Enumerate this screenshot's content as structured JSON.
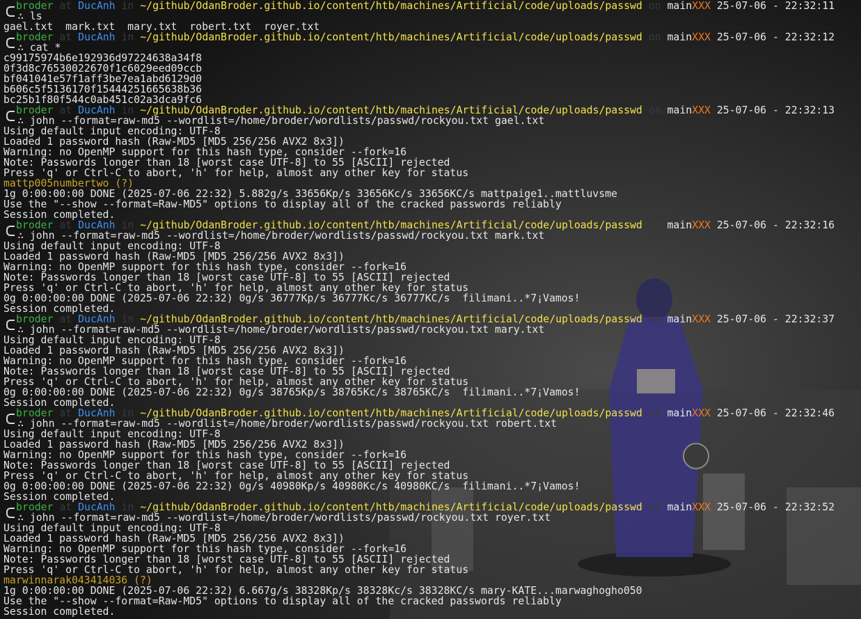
{
  "prompt": {
    "user": "broder",
    "at": "at",
    "host": "DucAnh",
    "in": "in",
    "path": "~/github/OdanBroder.github.io/content/htb/machines/Artificial/code/uploads/passwd",
    "on": "on",
    "branch": "main",
    "flags": "XXX",
    "arrow": "∴"
  },
  "colors": {
    "user": "#3cb043",
    "host": "#3f8ff0",
    "path": "#f4e24a",
    "flags": "#f07a1e",
    "found": "#c9a227"
  },
  "lines": [
    {
      "type": "prompt",
      "time": "25-07-06 - 22:32:11"
    },
    {
      "type": "cmd",
      "text": "ls"
    },
    {
      "type": "out",
      "text": "gael.txt  mark.txt  mary.txt  robert.txt  royer.txt"
    },
    {
      "type": "prompt",
      "time": "25-07-06 - 22:32:12"
    },
    {
      "type": "cmd",
      "text": "cat *"
    },
    {
      "type": "out",
      "text": "c99175974b6e192936d97224638a34f8"
    },
    {
      "type": "out",
      "text": "0f3d8c76530022670f1c6029eed09ccb"
    },
    {
      "type": "out",
      "text": "bf041041e57f1aff3be7ea1abd6129d0"
    },
    {
      "type": "out",
      "text": "b606c5f5136170f15444251665638b36"
    },
    {
      "type": "out",
      "text": "bc25b1f80f544c0ab451c02a3dca9fc6"
    },
    {
      "type": "prompt",
      "time": "25-07-06 - 22:32:13"
    },
    {
      "type": "cmd",
      "text": "john --format=raw-md5 --wordlist=/home/broder/wordlists/passwd/rockyou.txt gael.txt"
    },
    {
      "type": "out",
      "text": "Using default input encoding: UTF-8"
    },
    {
      "type": "out",
      "text": "Loaded 1 password hash (Raw-MD5 [MD5 256/256 AVX2 8x3])"
    },
    {
      "type": "out",
      "text": "Warning: no OpenMP support for this hash type, consider --fork=16"
    },
    {
      "type": "out",
      "text": "Note: Passwords longer than 18 [worst case UTF-8] to 55 [ASCII] rejected"
    },
    {
      "type": "out",
      "text": "Press 'q' or Ctrl-C to abort, 'h' for help, almost any other key for status"
    },
    {
      "type": "found",
      "text": "mattp005numbertwo (?)"
    },
    {
      "type": "out",
      "text": "1g 0:00:00:00 DONE (2025-07-06 22:32) 5.882g/s 33656Kp/s 33656Kc/s 33656KC/s mattpaige1..mattluvsme"
    },
    {
      "type": "out",
      "text": "Use the \"--show --format=Raw-MD5\" options to display all of the cracked passwords reliably"
    },
    {
      "type": "out",
      "text": "Session completed."
    },
    {
      "type": "prompt",
      "time": "25-07-06 - 22:32:16"
    },
    {
      "type": "cmd",
      "text": "john --format=raw-md5 --wordlist=/home/broder/wordlists/passwd/rockyou.txt mark.txt"
    },
    {
      "type": "out",
      "text": "Using default input encoding: UTF-8"
    },
    {
      "type": "out",
      "text": "Loaded 1 password hash (Raw-MD5 [MD5 256/256 AVX2 8x3])"
    },
    {
      "type": "out",
      "text": "Warning: no OpenMP support for this hash type, consider --fork=16"
    },
    {
      "type": "out",
      "text": "Note: Passwords longer than 18 [worst case UTF-8] to 55 [ASCII] rejected"
    },
    {
      "type": "out",
      "text": "Press 'q' or Ctrl-C to abort, 'h' for help, almost any other key for status"
    },
    {
      "type": "out",
      "text": "0g 0:00:00:00 DONE (2025-07-06 22:32) 0g/s 36777Kp/s 36777Kc/s 36777KC/s  filimani..*7¡Vamos!"
    },
    {
      "type": "out",
      "text": "Session completed."
    },
    {
      "type": "prompt",
      "time": "25-07-06 - 22:32:37"
    },
    {
      "type": "cmd",
      "text": "john --format=raw-md5 --wordlist=/home/broder/wordlists/passwd/rockyou.txt mary.txt"
    },
    {
      "type": "out",
      "text": "Using default input encoding: UTF-8"
    },
    {
      "type": "out",
      "text": "Loaded 1 password hash (Raw-MD5 [MD5 256/256 AVX2 8x3])"
    },
    {
      "type": "out",
      "text": "Warning: no OpenMP support for this hash type, consider --fork=16"
    },
    {
      "type": "out",
      "text": "Note: Passwords longer than 18 [worst case UTF-8] to 55 [ASCII] rejected"
    },
    {
      "type": "out",
      "text": "Press 'q' or Ctrl-C to abort, 'h' for help, almost any other key for status"
    },
    {
      "type": "out",
      "text": "0g 0:00:00:00 DONE (2025-07-06 22:32) 0g/s 38765Kp/s 38765Kc/s 38765KC/s  filimani..*7¡Vamos!"
    },
    {
      "type": "out",
      "text": "Session completed."
    },
    {
      "type": "prompt",
      "time": "25-07-06 - 22:32:46"
    },
    {
      "type": "cmd",
      "text": "john --format=raw-md5 --wordlist=/home/broder/wordlists/passwd/rockyou.txt robert.txt"
    },
    {
      "type": "out",
      "text": "Using default input encoding: UTF-8"
    },
    {
      "type": "out",
      "text": "Loaded 1 password hash (Raw-MD5 [MD5 256/256 AVX2 8x3])"
    },
    {
      "type": "out",
      "text": "Warning: no OpenMP support for this hash type, consider --fork=16"
    },
    {
      "type": "out",
      "text": "Note: Passwords longer than 18 [worst case UTF-8] to 55 [ASCII] rejected"
    },
    {
      "type": "out",
      "text": "Press 'q' or Ctrl-C to abort, 'h' for help, almost any other key for status"
    },
    {
      "type": "out",
      "text": "0g 0:00:00:00 DONE (2025-07-06 22:32) 0g/s 40980Kp/s 40980Kc/s 40980KC/s  filimani..*7¡Vamos!"
    },
    {
      "type": "out",
      "text": "Session completed."
    },
    {
      "type": "prompt",
      "time": "25-07-06 - 22:32:52"
    },
    {
      "type": "cmd",
      "text": "john --format=raw-md5 --wordlist=/home/broder/wordlists/passwd/rockyou.txt royer.txt"
    },
    {
      "type": "out",
      "text": "Using default input encoding: UTF-8"
    },
    {
      "type": "out",
      "text": "Loaded 1 password hash (Raw-MD5 [MD5 256/256 AVX2 8x3])"
    },
    {
      "type": "out",
      "text": "Warning: no OpenMP support for this hash type, consider --fork=16"
    },
    {
      "type": "out",
      "text": "Note: Passwords longer than 18 [worst case UTF-8] to 55 [ASCII] rejected"
    },
    {
      "type": "out",
      "text": "Press 'q' or Ctrl-C to abort, 'h' for help, almost any other key for status"
    },
    {
      "type": "found",
      "text": "marwinnarak043414036 (?)"
    },
    {
      "type": "out",
      "text": "1g 0:00:00:00 DONE (2025-07-06 22:32) 6.667g/s 38328Kp/s 38328Kc/s 38328KC/s mary-KATE...marwaghogho050"
    },
    {
      "type": "out",
      "text": "Use the \"--show --format=Raw-MD5\" options to display all of the cracked passwords reliably"
    },
    {
      "type": "out",
      "text": "Session completed."
    }
  ]
}
